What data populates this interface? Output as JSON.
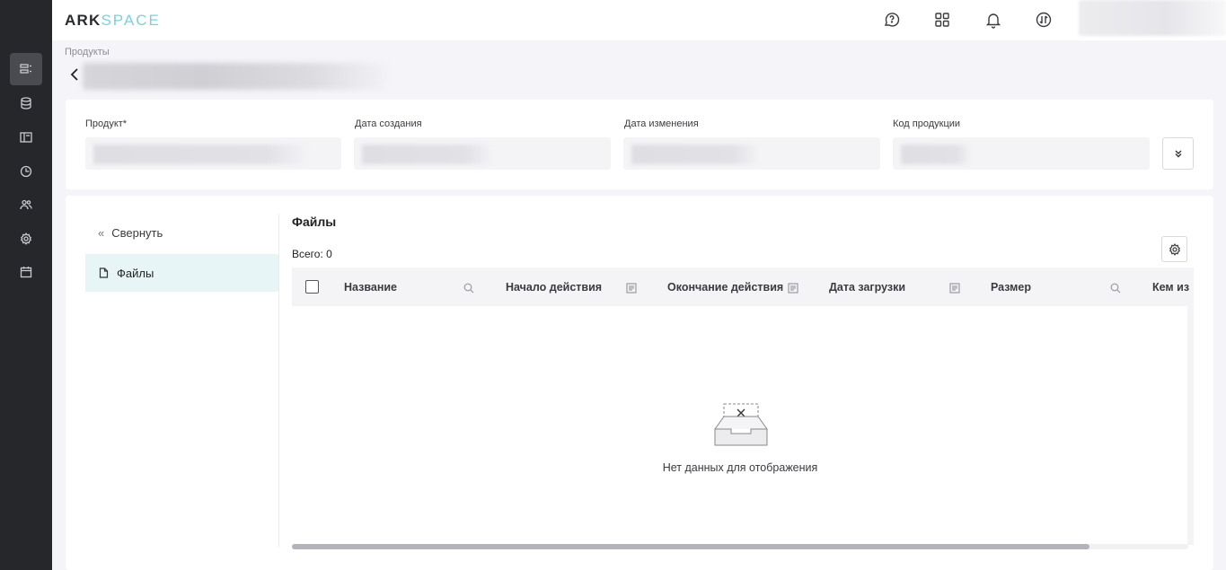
{
  "header": {
    "logo_part1": "ARK",
    "logo_part2": "SPACE"
  },
  "rail": {
    "items": [
      {
        "icon": "list-icon",
        "active": true
      },
      {
        "icon": "database-icon",
        "active": false
      },
      {
        "icon": "layout-icon",
        "active": false
      },
      {
        "icon": "pie-chart-icon",
        "active": false
      },
      {
        "icon": "users-icon",
        "active": false
      },
      {
        "icon": "gear-icon",
        "active": false
      },
      {
        "icon": "calendar-icon",
        "active": false
      }
    ]
  },
  "header_icons": [
    "help-chat-icon",
    "apps-grid-icon",
    "bell-icon",
    "sync-icon"
  ],
  "breadcrumb": "Продукты",
  "fields": {
    "product_label": "Продукт*",
    "created_label": "Дата создания",
    "modified_label": "Дата изменения",
    "code_label": "Код продукции"
  },
  "side": {
    "collapse_label": "Свернуть",
    "files_label": "Файлы"
  },
  "files": {
    "title": "Файлы",
    "total": "Всего: 0",
    "columns": [
      "Название",
      "Начало действия",
      "Окончание действия",
      "Дата загрузки",
      "Размер",
      "Кем из"
    ],
    "empty_text": "Нет данных для отображения",
    "scroll_fraction": 0.89
  }
}
